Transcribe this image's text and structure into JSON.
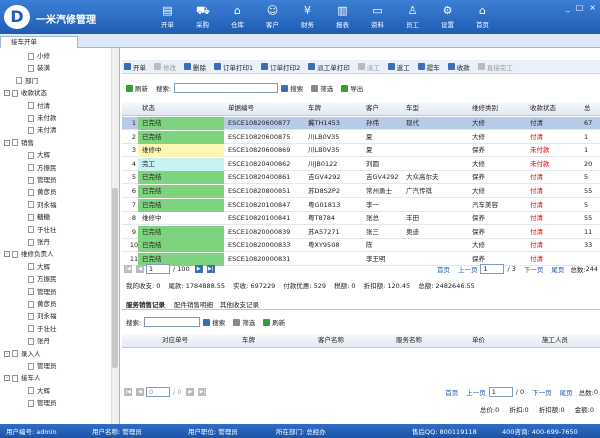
{
  "app": {
    "logo_text": "D",
    "title": "一米汽修管理"
  },
  "nav": [
    {
      "label": "开单",
      "icon": "document-icon"
    },
    {
      "label": "采购",
      "icon": "cart-icon"
    },
    {
      "label": "仓库",
      "icon": "warehouse-icon"
    },
    {
      "label": "客户",
      "icon": "user-icon"
    },
    {
      "label": "财务",
      "icon": "money-icon"
    },
    {
      "label": "报表",
      "icon": "chart-icon"
    },
    {
      "label": "资料",
      "icon": "folder-icon"
    },
    {
      "label": "员工",
      "icon": "staff-icon"
    },
    {
      "label": "设置",
      "icon": "gear-icon"
    },
    {
      "label": "首页",
      "icon": "home-icon"
    }
  ],
  "window_controls": [
    "_",
    "□",
    "×"
  ],
  "active_tab": "接车开单",
  "tree": [
    {
      "label": "小修",
      "level": 3
    },
    {
      "label": "装潢",
      "level": 3
    },
    {
      "label": "部门",
      "level": 2
    },
    {
      "label": "收款状态",
      "level": 1,
      "toggle": "-"
    },
    {
      "label": "付清",
      "level": 3
    },
    {
      "label": "未付款",
      "level": 3
    },
    {
      "label": "未付清",
      "level": 3
    },
    {
      "label": "销售",
      "level": 1,
      "toggle": "-"
    },
    {
      "label": "大辉",
      "level": 3
    },
    {
      "label": "方振民",
      "level": 3
    },
    {
      "label": "管理员",
      "level": 3
    },
    {
      "label": "黄彦员",
      "level": 3
    },
    {
      "label": "刘永福",
      "level": 3
    },
    {
      "label": "糖糖",
      "level": 3
    },
    {
      "label": "于壮壮",
      "level": 3
    },
    {
      "label": "张丹",
      "level": 3
    },
    {
      "label": "维修负责人",
      "level": 1,
      "toggle": "-"
    },
    {
      "label": "大辉",
      "level": 3
    },
    {
      "label": "方振民",
      "level": 3
    },
    {
      "label": "管理员",
      "level": 3
    },
    {
      "label": "黄彦员",
      "level": 3
    },
    {
      "label": "刘永福",
      "level": 3
    },
    {
      "label": "于壮壮",
      "level": 3
    },
    {
      "label": "张丹",
      "level": 3
    },
    {
      "label": "录入人",
      "level": 1,
      "toggle": "-"
    },
    {
      "label": "管理员",
      "level": 3
    },
    {
      "label": "接车人",
      "level": 1,
      "toggle": "-"
    },
    {
      "label": "大辉",
      "level": 3
    },
    {
      "label": "管理员",
      "level": 3
    }
  ],
  "toolbar": [
    {
      "label": "开单",
      "enabled": true
    },
    {
      "label": "修改",
      "enabled": false
    },
    {
      "label": "删除",
      "enabled": true
    },
    {
      "label": "订单打印1",
      "enabled": true
    },
    {
      "label": "订单打印2",
      "enabled": true
    },
    {
      "label": "派工单打印",
      "enabled": true
    },
    {
      "label": "派工",
      "enabled": false
    },
    {
      "label": "返工",
      "enabled": true
    },
    {
      "label": "提车",
      "enabled": true
    },
    {
      "label": "收款",
      "enabled": true
    },
    {
      "label": "直接完工",
      "enabled": false
    }
  ],
  "search": {
    "refresh": "刷新",
    "label": "搜索:",
    "search_btn": "搜索",
    "filter": "筛选",
    "export": "导出"
  },
  "grid": {
    "columns": [
      "",
      "状态",
      "单据编号",
      "车牌",
      "客户",
      "车型",
      "维修类别",
      "收款状态",
      "总"
    ],
    "rows": [
      {
        "n": "1",
        "status": "已完结",
        "sc": "green",
        "no": "ESCE10820600877",
        "plate": "冀TH1453",
        "cust": "孙伟",
        "model": "现代",
        "type": "大修",
        "pay": "付清",
        "pr": false,
        "amt": "67"
      },
      {
        "n": "2",
        "status": "已完结",
        "sc": "green",
        "no": "ESCE10820600875",
        "plate": "川LB0V35",
        "cust": "夏",
        "model": "",
        "type": "大修",
        "pay": "付清",
        "pr": true,
        "amt": "1"
      },
      {
        "n": "3",
        "status": "维修中",
        "sc": "yellow",
        "no": "ESCE10820600869",
        "plate": "川LB0V35",
        "cust": "夏",
        "model": "",
        "type": "保养",
        "pay": "未付款",
        "pr": true,
        "amt": "1"
      },
      {
        "n": "4",
        "status": "完工",
        "sc": "cyan",
        "no": "ESCE10820400862",
        "plate": "川JB0122",
        "cust": "刘圆",
        "model": "",
        "type": "大修",
        "pay": "未付款",
        "pr": true,
        "amt": "20"
      },
      {
        "n": "5",
        "status": "已完结",
        "sc": "green",
        "no": "ESCE10820400861",
        "plate": "吉GV4292",
        "cust": "吉GV4292",
        "model": "大众高尔夫",
        "type": "保养",
        "pay": "付清",
        "pr": true,
        "amt": "5"
      },
      {
        "n": "6",
        "status": "已完结",
        "sc": "green",
        "no": "ESCE10820800851",
        "plate": "苏D8S2P2",
        "cust": "常州勇士",
        "model": "广汽传祺",
        "type": "大修",
        "pay": "付清",
        "pr": true,
        "amt": "55"
      },
      {
        "n": "7",
        "status": "已完结",
        "sc": "green",
        "no": "ESCE10820100847",
        "plate": "粤G01813",
        "cust": "李一",
        "model": "",
        "type": "汽车美容",
        "pay": "付清",
        "pr": true,
        "amt": "5"
      },
      {
        "n": "8",
        "status": "维修中",
        "sc": "none",
        "no": "ESCE10820100841",
        "plate": "粤T8784",
        "cust": "张总",
        "model": "丰田",
        "type": "保养",
        "pay": "付清",
        "pr": true,
        "amt": "55"
      },
      {
        "n": "9",
        "status": "已完结",
        "sc": "green",
        "no": "ESCE10820000839",
        "plate": "苏A57271",
        "cust": "张三",
        "model": "奥迪",
        "type": "保养",
        "pay": "付清",
        "pr": true,
        "amt": "11"
      },
      {
        "n": "10",
        "status": "已完结",
        "sc": "green",
        "no": "ESCE10820000833",
        "plate": "粤XY9508",
        "cust": "陈",
        "model": "",
        "type": "大修",
        "pay": "付清",
        "pr": true,
        "amt": "33"
      },
      {
        "n": "11",
        "status": "已完结",
        "sc": "green",
        "no": "ESCE10820000831",
        "plate": "",
        "cust": "李王明",
        "model": "",
        "type": "保养",
        "pay": "付清",
        "pr": true,
        "amt": ""
      }
    ]
  },
  "pager": {
    "page": "1",
    "of": "/ 100",
    "first": "首页",
    "prev": "上一页",
    "page2": "1",
    "of2": "/ 3",
    "next": "下一页",
    "last": "尾页",
    "total_label": "总数:",
    "total": "244"
  },
  "summary": {
    "text1": "我的收支:",
    "v1": "0",
    "text2": "尾款:",
    "v2": "1784888.55",
    "text3": "实收:",
    "v3": "697229",
    "text4": "付款优惠:",
    "v4": "529",
    "text5": "税额:",
    "v5": "0",
    "text6": "折扣额:",
    "v6": "120.45",
    "text7": "总额:",
    "v7": "2482646.55"
  },
  "lower_tabs": [
    "服务销售记录",
    "配件销售明细",
    "其他收支记录"
  ],
  "lower_search": {
    "label": "搜索:",
    "search_btn": "搜索",
    "filter": "筛选",
    "refresh": "刷新"
  },
  "lower_grid": {
    "columns": [
      "对应单号",
      "车牌",
      "客户名称",
      "服务名称",
      "单价",
      "施工人员"
    ]
  },
  "pager2": {
    "page": "0",
    "of": "/ 0",
    "first": "首页",
    "prev": "上一页",
    "page2": "1",
    "of2": "/ 0",
    "next": "下一页",
    "last": "尾页",
    "total_label": "总数:",
    "total": "0"
  },
  "summary2": {
    "t1": "总价:",
    "v1": "0",
    "t2": "折扣:",
    "v2": "0",
    "t3": "折扣额:",
    "v3": "0",
    "t4": "金额:",
    "v4": "0"
  },
  "bottom": {
    "user_id_label": "用户编号:",
    "user_id": "admin",
    "user_name_label": "用户名称:",
    "user_name": "管理员",
    "position_label": "用户职位:",
    "position": "管理员",
    "dept_label": "所在部门:",
    "dept": "总经办",
    "qq_label": "售后QQ:",
    "qq": "800119118",
    "phone_label": "400咨询:",
    "phone": "400-699-7650"
  }
}
